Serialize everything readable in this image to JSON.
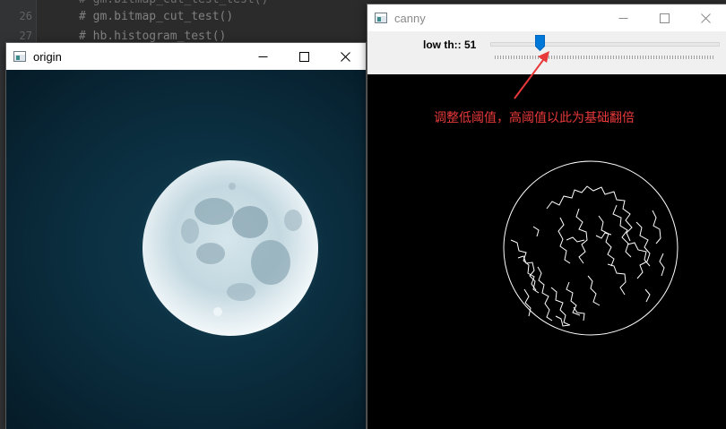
{
  "ide": {
    "line_numbers": [
      "26",
      "27",
      "",
      "",
      "",
      "",
      "",
      "",
      "",
      "",
      "",
      "",
      "",
      "",
      "",
      "",
      "",
      "",
      "",
      "",
      "",
      ""
    ],
    "code": {
      "top_partial": "# gm.bitmap_cut_test_test()",
      "line1": "# gm.bitmap_cut_test()",
      "line2": "# hb.histogram_test()"
    }
  },
  "origin_window": {
    "title": "origin",
    "icon": "app-window-icon",
    "controls": [
      "minimize-icon",
      "maximize-icon",
      "close-icon"
    ]
  },
  "canny_window": {
    "title": "canny",
    "icon": "app-window-icon",
    "controls": [
      "minimize-icon",
      "maximize-icon",
      "close-icon"
    ],
    "trackbar": {
      "label": "low th:: 51",
      "value_fraction": 0.2
    }
  },
  "annotation": {
    "text": "调整低阈值，高阈值以此为基础翻倍",
    "color": "#e8393a"
  }
}
